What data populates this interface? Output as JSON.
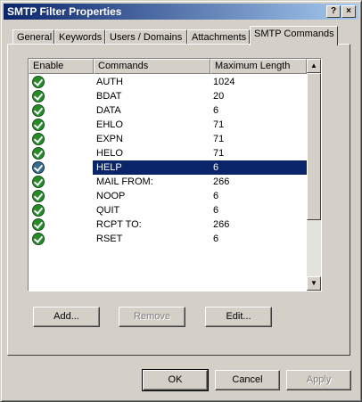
{
  "window": {
    "title": "SMTP Filter Properties",
    "help_label": "?",
    "close_label": "×"
  },
  "tabs": [
    {
      "label": "General"
    },
    {
      "label": "Keywords"
    },
    {
      "label": "Users / Domains"
    },
    {
      "label": "Attachments"
    },
    {
      "label": "SMTP Commands"
    }
  ],
  "selected_tab": "SMTP Commands",
  "table": {
    "headers": [
      "Enable",
      "Commands",
      "Maximum Length"
    ],
    "rows": [
      {
        "command": "AUTH",
        "max": "1024",
        "enabled": true
      },
      {
        "command": "BDAT",
        "max": "20",
        "enabled": true
      },
      {
        "command": "DATA",
        "max": "6",
        "enabled": true
      },
      {
        "command": "EHLO",
        "max": "71",
        "enabled": true
      },
      {
        "command": "EXPN",
        "max": "71",
        "enabled": true
      },
      {
        "command": "HELO",
        "max": "71",
        "enabled": true
      },
      {
        "command": "HELP",
        "max": "6",
        "enabled": true,
        "selected": true
      },
      {
        "command": "MAIL FROM:",
        "max": "266",
        "enabled": true
      },
      {
        "command": "NOOP",
        "max": "6",
        "enabled": true
      },
      {
        "command": "QUIT",
        "max": "6",
        "enabled": true
      },
      {
        "command": "RCPT TO:",
        "max": "266",
        "enabled": true
      },
      {
        "command": "RSET",
        "max": "6",
        "enabled": true
      }
    ]
  },
  "actions": {
    "add_label": "Add...",
    "remove_label": "Remove",
    "edit_label": "Edit..."
  },
  "footer": {
    "ok_label": "OK",
    "cancel_label": "Cancel",
    "apply_label": "Apply"
  },
  "colors": {
    "titlebar": "#0a246a",
    "selection": "#0a246a",
    "check": "#2a8a2a"
  }
}
